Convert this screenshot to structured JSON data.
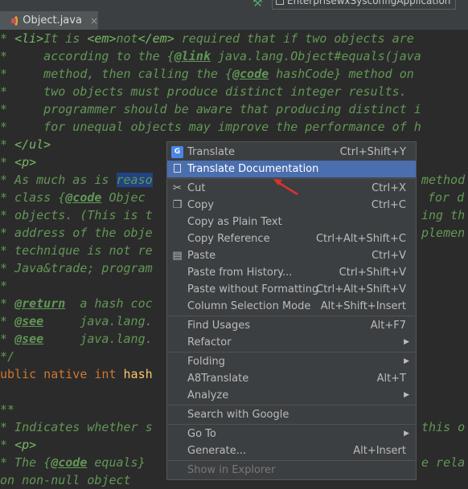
{
  "tab": {
    "filename": "Object.java",
    "close": "×"
  },
  "run_config": {
    "label": "EnterprisewxSysconfigApplication"
  },
  "code": {
    "l1": {
      "star": "* ",
      "li_open": "<li>",
      "t1": "It is ",
      "em_open": "<em>",
      "not": "not",
      "em_close": "</em>",
      "t2": " required that if two objects are"
    },
    "l2": {
      "pre": "*     according to the {",
      "link": "@link",
      "post": " java.lang.Object#equals(java"
    },
    "l3": {
      "pre": "*     method, then calling the {",
      "code": "@code",
      "post": " hashCode} method on"
    },
    "l4": {
      "text": "*     two objects must produce distinct integer results."
    },
    "l5": {
      "text": "*     programmer should be aware that producing distinct i"
    },
    "l6": {
      "text": "*     for unequal objects may improve the performance of h"
    },
    "l7": {
      "star": "* ",
      "ul_close": "</ul>"
    },
    "l8": {
      "star": "* ",
      "p": "<p>"
    },
    "l9": {
      "pre": "* As much as is ",
      "sel": "reaso",
      "post_right": "method"
    },
    "l10": {
      "pre": "* class {",
      "code": "@code",
      "post": " Objec",
      "right": "for d"
    },
    "l11": {
      "pre": "* objects. (This is t",
      "right": "ing th"
    },
    "l12": {
      "pre": "* address of the obje",
      "right": "plemen"
    },
    "l13": {
      "pre": "* technique is not re"
    },
    "l14": {
      "pre": "* Java&trade; program"
    },
    "l15": {
      "text": "*"
    },
    "l16": {
      "star": "* ",
      "tag": "@return",
      "post": "  a hash coc"
    },
    "l17": {
      "star": "* ",
      "tag": "@see",
      "post": "     java.lang."
    },
    "l18": {
      "star": "* ",
      "tag": "@see",
      "post": "     java.lang."
    },
    "l19": {
      "text": "*/"
    },
    "l20": {
      "pre": "ublic",
      "kw1": " native",
      "kw2": " int",
      "fn": " hash"
    },
    "l21": {
      "text": ""
    },
    "l22": {
      "text": "**"
    },
    "l23": {
      "pre": "* Indicates whether s",
      "right": "this o"
    },
    "l24": {
      "star": "* ",
      "p": "<p>"
    },
    "l25": {
      "pre": "* The {",
      "code": "@code",
      "post": " equals}",
      "right": "e rela"
    },
    "l26": {
      "pre": "on non-null object"
    }
  },
  "menu": {
    "items": [
      {
        "label": "Translate",
        "shortcut": "Ctrl+Shift+Y",
        "icon": "google-translate-icon"
      },
      {
        "label": "Translate Documentation",
        "shortcut": "",
        "highlighted": true
      },
      {
        "label": "Cut",
        "shortcut": "Ctrl+X",
        "icon": "scissors-icon"
      },
      {
        "label": "Copy",
        "shortcut": "Ctrl+C",
        "icon": "copy-icon"
      },
      {
        "label": "Copy as Plain Text",
        "shortcut": ""
      },
      {
        "label": "Copy Reference",
        "shortcut": "Ctrl+Alt+Shift+C"
      },
      {
        "label": "Paste",
        "shortcut": "Ctrl+V",
        "icon": "clipboard-icon"
      },
      {
        "label": "Paste from History...",
        "shortcut": "Ctrl+Shift+V"
      },
      {
        "label": "Paste without Formatting",
        "shortcut": "Ctrl+Alt+Shift+V"
      },
      {
        "label": "Column Selection Mode",
        "shortcut": "Alt+Shift+Insert"
      },
      {
        "label": "Find Usages",
        "shortcut": "Alt+F7"
      },
      {
        "label": "Refactor",
        "shortcut": "",
        "submenu": true
      },
      {
        "label": "Folding",
        "shortcut": "",
        "submenu": true
      },
      {
        "label": "A8Translate",
        "shortcut": "Alt+T"
      },
      {
        "label": "Analyze",
        "shortcut": "",
        "submenu": true
      },
      {
        "label": "Search with Google",
        "shortcut": ""
      },
      {
        "label": "Go To",
        "shortcut": "",
        "submenu": true
      },
      {
        "label": "Generate...",
        "shortcut": "Alt+Insert"
      },
      {
        "label": "Show in Explorer",
        "shortcut": "",
        "disabled": true
      }
    ]
  },
  "colors": {
    "background": "#2b2b2b",
    "comment": "#629755",
    "keyword": "#cc7832",
    "menu_bg": "#3c3f41",
    "menu_highlight": "#4b6eaf",
    "selection": "#214283",
    "annotation_arrow": "#e03030"
  }
}
